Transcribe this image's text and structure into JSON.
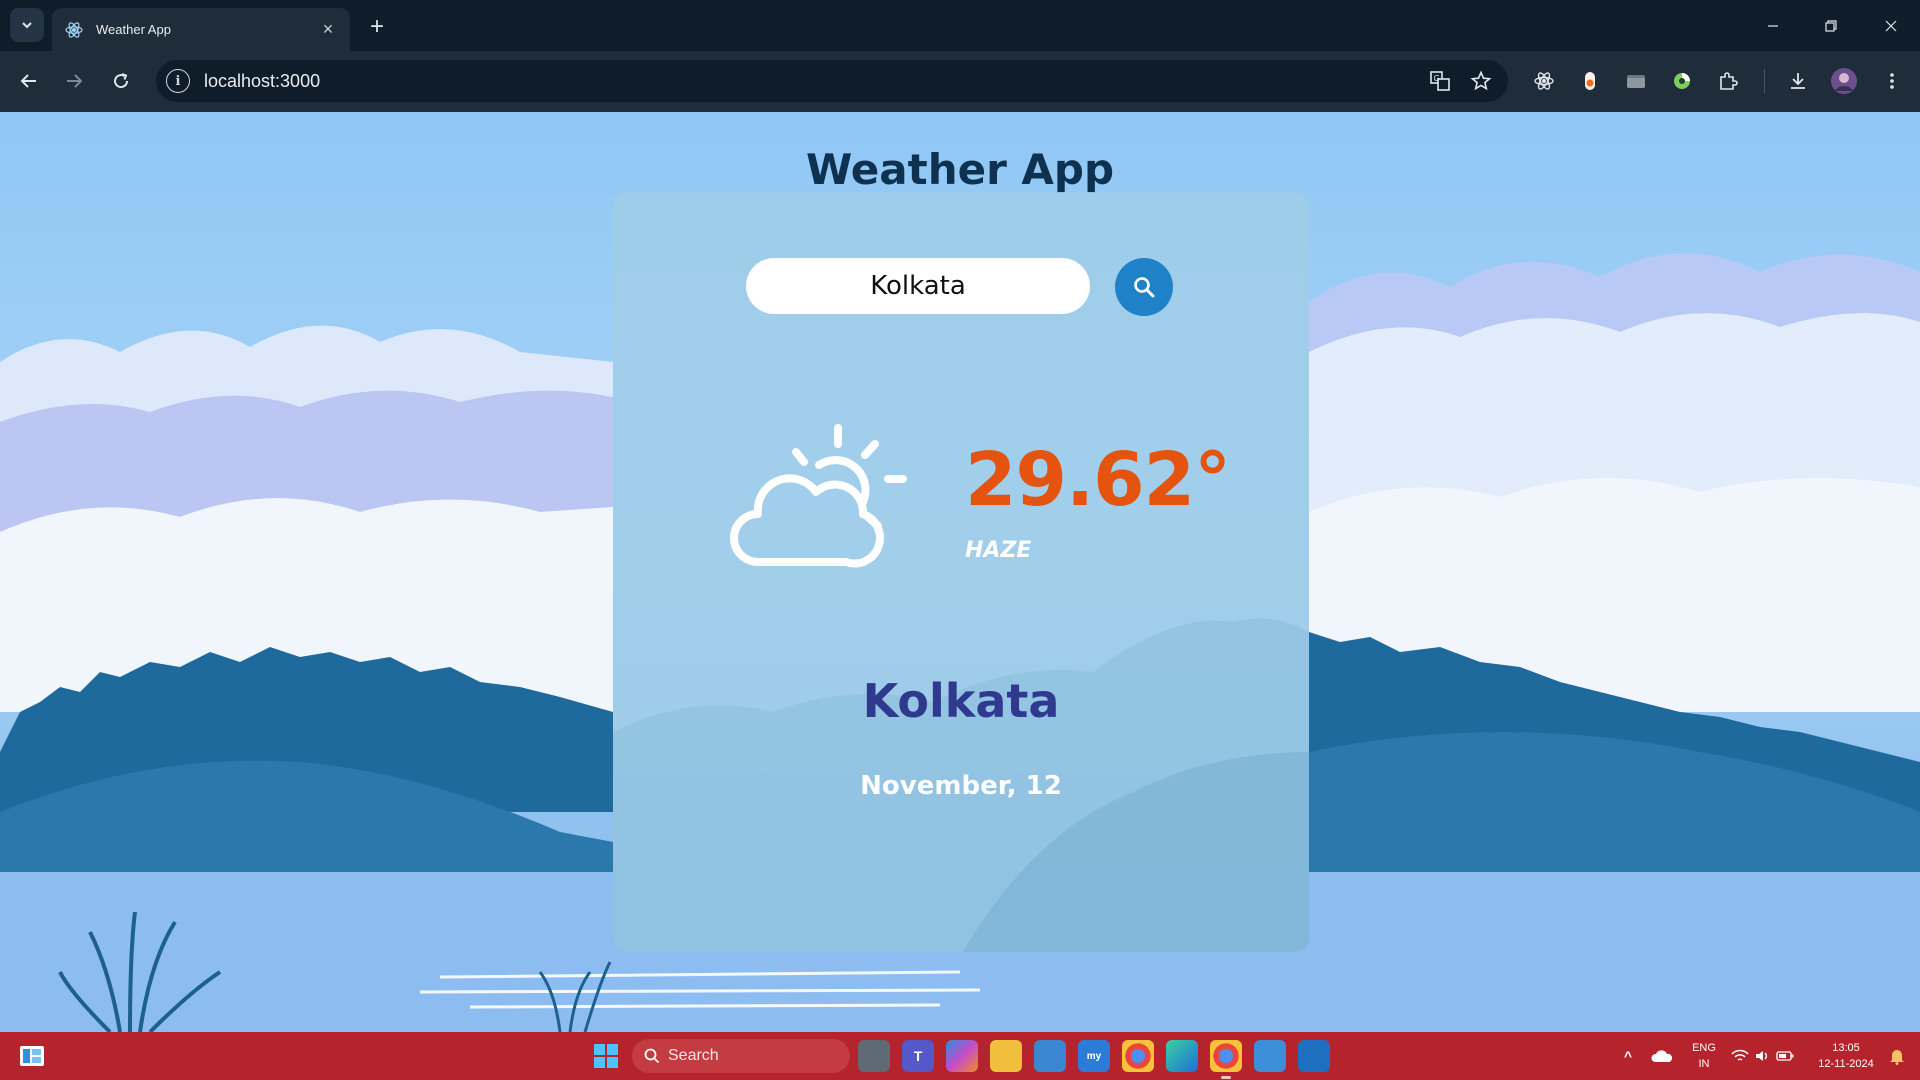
{
  "browser": {
    "tab_title": "Weather App",
    "url": "localhost:3000"
  },
  "app": {
    "title": "Weather App",
    "search": {
      "value": "Kolkata"
    },
    "weather": {
      "temperature": "29.62°",
      "condition": "HAZE",
      "city": "Kolkata",
      "date": "November, 12",
      "icon": "partly-cloudy-icon"
    },
    "colors": {
      "temperature": "#e4540f",
      "city": "#2f3a8f",
      "title": "#0f3150",
      "search_button": "#1f82c8"
    }
  },
  "taskbar": {
    "search_label": "Search",
    "language": "ENG",
    "region": "IN",
    "time": "13:05",
    "date": "12-11-2024"
  }
}
